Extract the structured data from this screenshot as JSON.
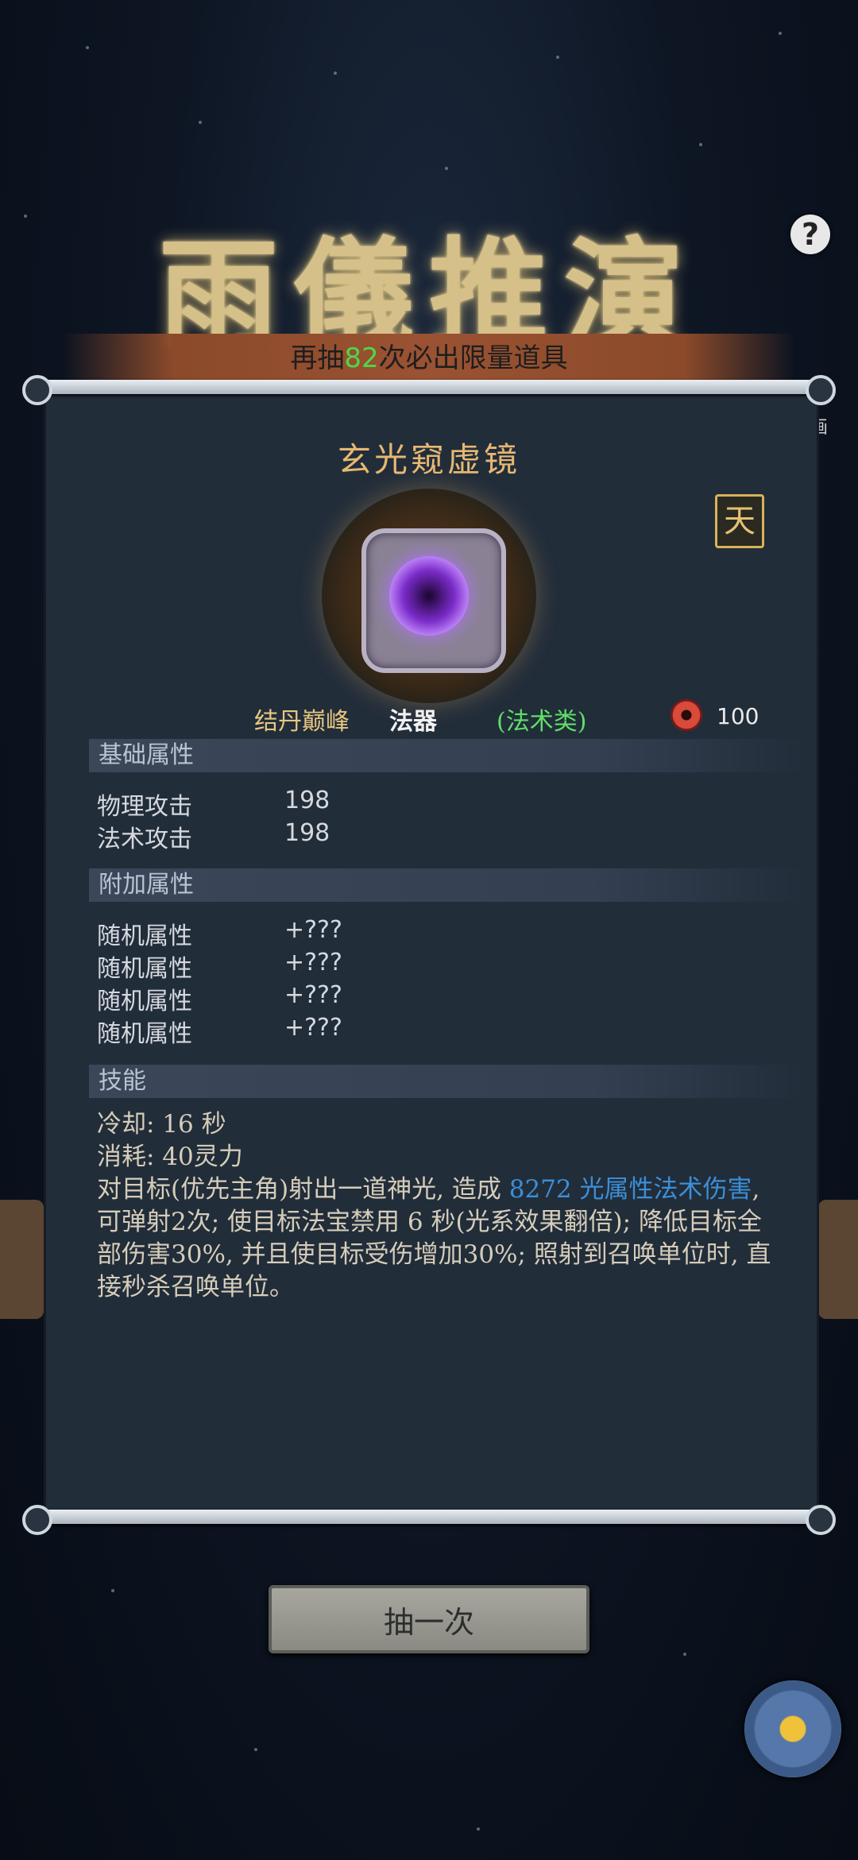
{
  "header": {
    "title": "雨儀推演",
    "help_label": "?",
    "banner_prefix": "再抽",
    "banner_count": "82",
    "banner_suffix": "次必出限量道具"
  },
  "item": {
    "name": "玄光窥虚镜",
    "grade_badge": "天",
    "realm": "结丹巅峰",
    "kind": "法器",
    "category": "(法术类)",
    "cost": "100"
  },
  "base_attrs": {
    "heading": "基础属性",
    "rows": [
      {
        "label": "物理攻击",
        "value": "198"
      },
      {
        "label": "法术攻击",
        "value": "198"
      }
    ]
  },
  "extra_attrs": {
    "heading": "附加属性",
    "rows": [
      {
        "label": "随机属性",
        "value": "+???"
      },
      {
        "label": "随机属性",
        "value": "+???"
      },
      {
        "label": "随机属性",
        "value": "+???"
      },
      {
        "label": "随机属性",
        "value": "+???"
      }
    ]
  },
  "skill": {
    "heading": "技能",
    "cooldown": "冷却: 16 秒",
    "consume": "消耗: 40灵力",
    "desc_part1": "对目标(优先主角)射出一道神光, 造成 ",
    "damage": "8272 光属性法术伤害",
    "desc_part2": ", 可弹射2次; 使目标法宝禁用 6 秒(光系效果翻倍); 降低目标全部伤害30%, 并且使目标受伤增加30%; 照射到召唤单位时, 直接秒杀召唤单位。"
  },
  "actions": {
    "draw_once": "抽一次"
  },
  "side": {
    "right_text": "画"
  },
  "colors": {
    "title_gold": "#d6c08a",
    "count_green": "#4fd64a",
    "category_green": "#5fe067",
    "damage_blue": "#3b8fd8",
    "panel_bg": "#222d3a"
  }
}
